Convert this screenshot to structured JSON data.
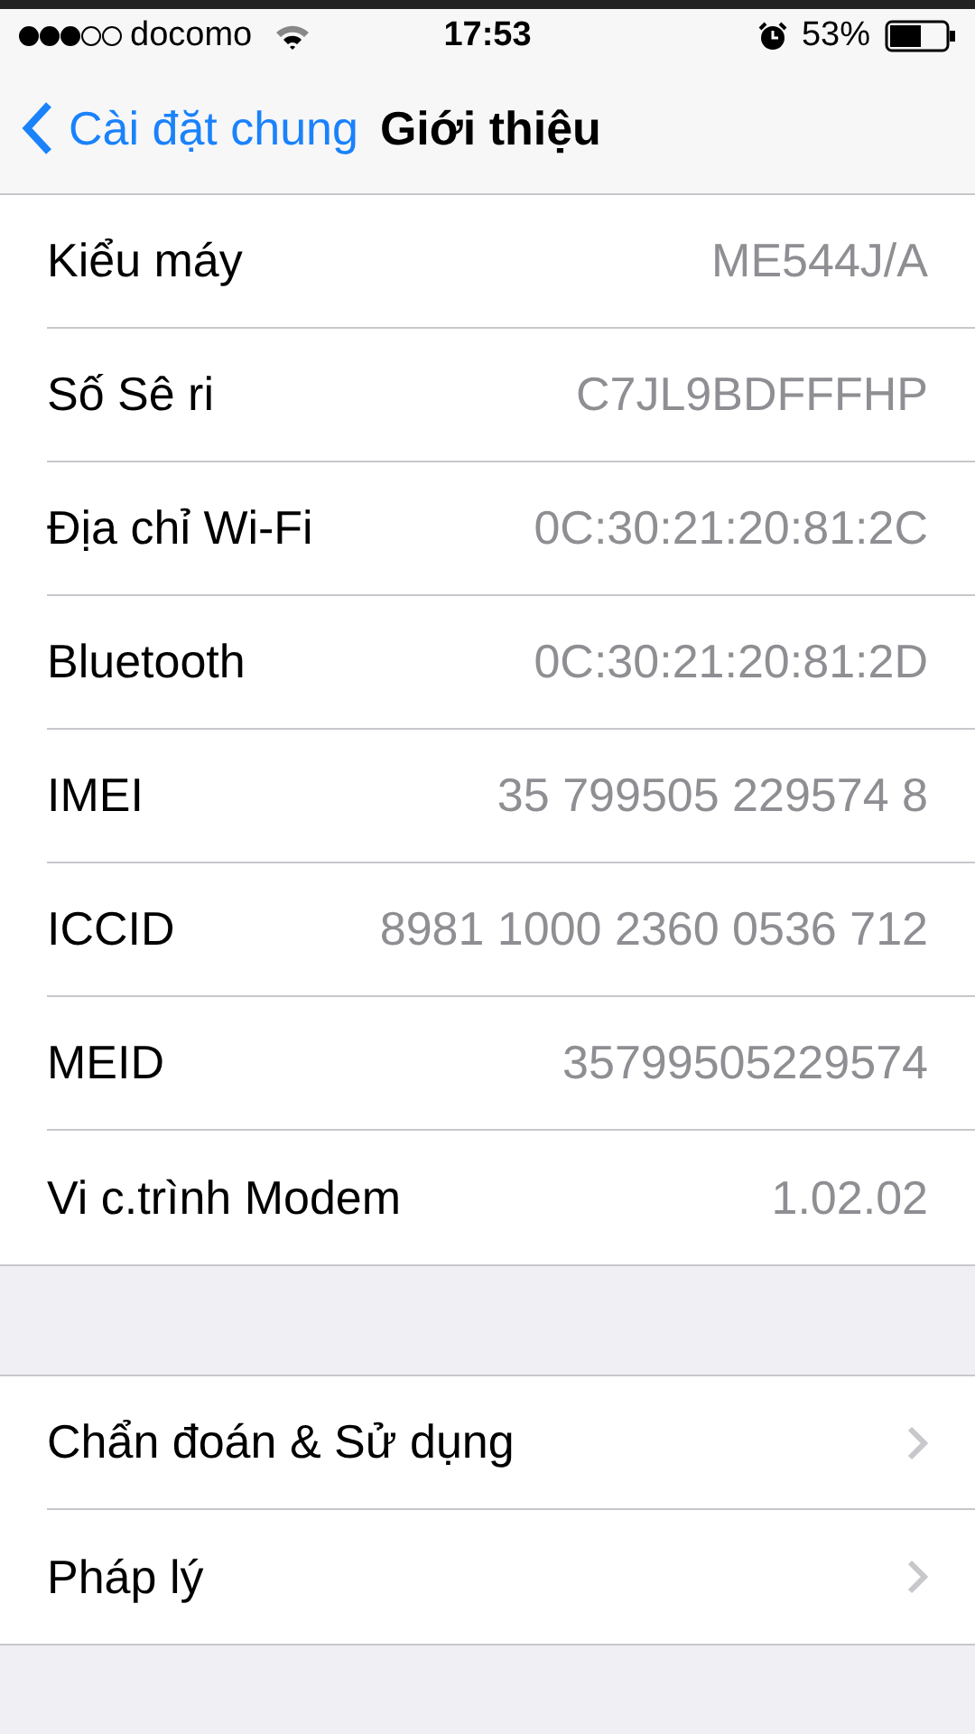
{
  "status_bar": {
    "carrier": "docomo",
    "time": "17:53",
    "battery": "53%"
  },
  "nav": {
    "back": "Cài đặt chung",
    "title": "Giới thiệu"
  },
  "info_rows": [
    {
      "label": "Kiểu máy",
      "value": "ME544J/A"
    },
    {
      "label": "Số Sê ri",
      "value": "C7JL9BDFFFHP"
    },
    {
      "label": "Địa chỉ Wi-Fi",
      "value": "0C:30:21:20:81:2C"
    },
    {
      "label": "Bluetooth",
      "value": "0C:30:21:20:81:2D"
    },
    {
      "label": "IMEI",
      "value": "35 799505 229574 8"
    },
    {
      "label": "ICCID",
      "value": "8981 1000 2360 0536 712"
    },
    {
      "label": "MEID",
      "value": "35799505229574"
    },
    {
      "label": "Vi c.trình Modem",
      "value": "1.02.02"
    }
  ],
  "link_rows": [
    {
      "label": "Chẩn đoán & Sử dụng"
    },
    {
      "label": "Pháp lý"
    }
  ]
}
